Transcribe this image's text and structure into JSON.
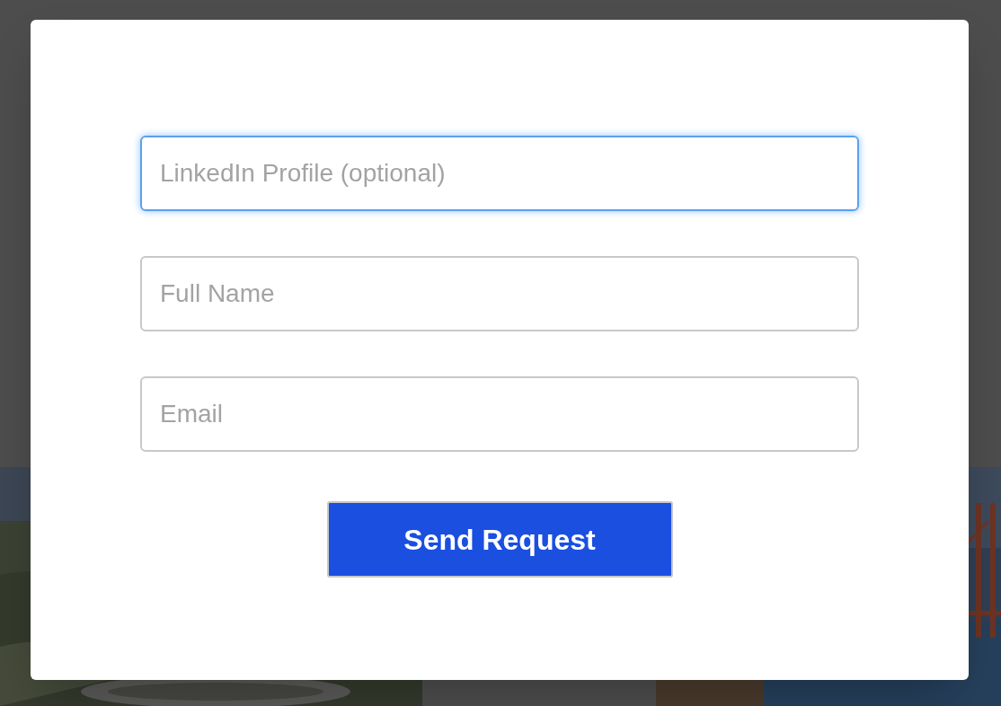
{
  "photos": [
    {
      "kind": "picture"
    },
    {
      "kind": "empty"
    },
    {
      "kind": "picture"
    }
  ],
  "modal": {
    "fields": [
      {
        "placeholder": "LinkedIn Profile (optional)",
        "focused": true
      },
      {
        "placeholder": "Full Name",
        "focused": false
      },
      {
        "placeholder": "Email",
        "focused": false
      }
    ],
    "submit_button": "Send Request"
  }
}
